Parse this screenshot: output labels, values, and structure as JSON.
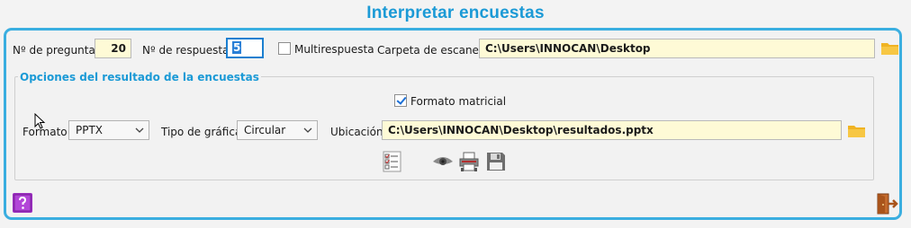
{
  "window": {
    "title": "Interpretar encuestas"
  },
  "top_row": {
    "preguntas_label": "Nº de preguntas",
    "preguntas_value": "20",
    "respuestas_label": "Nº de respuestas",
    "respuestas_value": "5",
    "multirespuesta_label": "Multirespuesta",
    "multirespuesta_checked": false,
    "carpeta_label": "Carpeta de escaneos",
    "carpeta_value": "C:\\Users\\INNOCAN\\Desktop"
  },
  "options_group": {
    "title": "Opciones del resultado de la encuestas",
    "formato_matricial_label": "Formato matricial",
    "formato_matricial_checked": true,
    "formato_label": "Formato",
    "formato_value": "PPTX",
    "tipo_grafica_label": "Tipo de gráfica",
    "tipo_grafica_value": "Circular",
    "ubicacion_label": "Ubicación",
    "ubicacion_value": "C:\\Users\\INNOCAN\\Desktop\\resultados.pptx"
  },
  "icons": {
    "folder": "folder-icon",
    "checklist": "checklist-icon",
    "eye": "eye-icon",
    "print": "printer-icon",
    "save": "save-icon",
    "help": "help-icon",
    "exit": "exit-door-icon"
  },
  "colors": {
    "accent": "#1b9ad6",
    "panel_border": "#3aaee0",
    "field_bg": "#fefad6",
    "help_bg": "#9b2fc0",
    "folder": "#f0b323",
    "exit": "#a9541b"
  }
}
